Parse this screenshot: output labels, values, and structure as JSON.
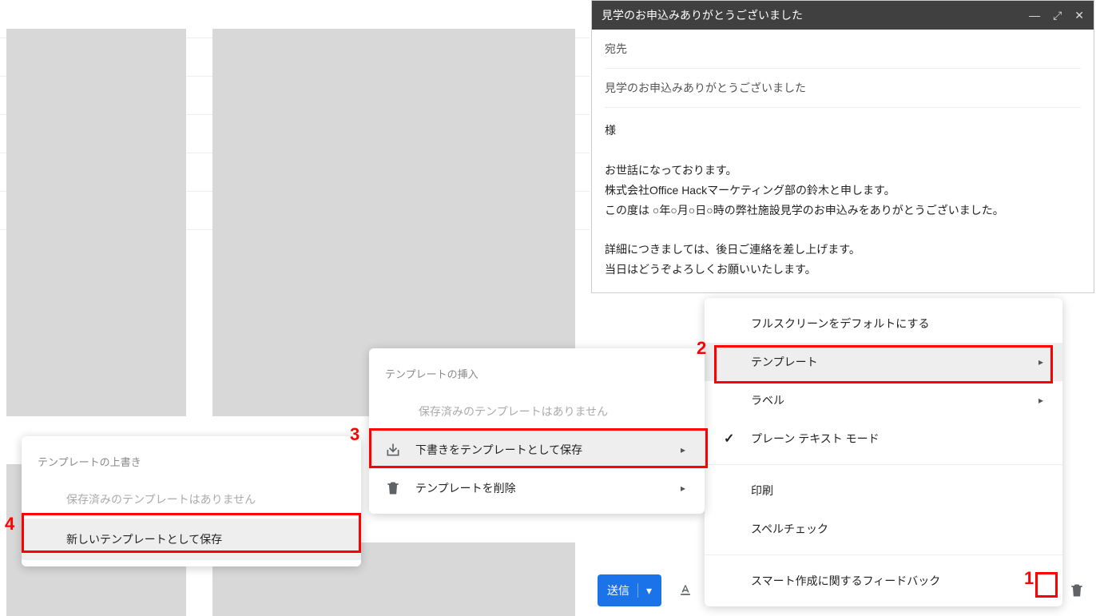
{
  "compose": {
    "window_title": "見学のお申込みありがとうございました",
    "to_label": "宛先",
    "subject": "見学のお申込みありがとうございました",
    "body_line1": "様",
    "body_line2": "お世話になっております。",
    "body_line3": "株式会社Office Hackマーケティング部の鈴木と申します。",
    "body_line4": "この度は ○年○月○日○時の弊社施設見学のお申込みをありがとうございました。",
    "body_line5": "詳細につきましては、後日ご連絡を差し上げます。",
    "body_line6": "当日はどうぞよろしくお願いいたします。",
    "send_label": "送信"
  },
  "options_menu": {
    "item1": "フルスクリーンをデフォルトにする",
    "item2": "テンプレート",
    "item3": "ラベル",
    "item4": "プレーン テキスト モード",
    "item5": "印刷",
    "item6": "スペルチェック",
    "item7": "スマート作成に関するフィードバック"
  },
  "template_menu": {
    "header": "テンプレートの挿入",
    "empty": "保存済みのテンプレートはありません",
    "item_save": "下書きをテンプレートとして保存",
    "item_delete": "テンプレートを削除"
  },
  "save_menu": {
    "header": "テンプレートの上書き",
    "empty": "保存済みのテンプレートはありません",
    "item_new": "新しいテンプレートとして保存"
  },
  "annotations": {
    "n1": "1",
    "n2": "2",
    "n3": "3",
    "n4": "4"
  }
}
